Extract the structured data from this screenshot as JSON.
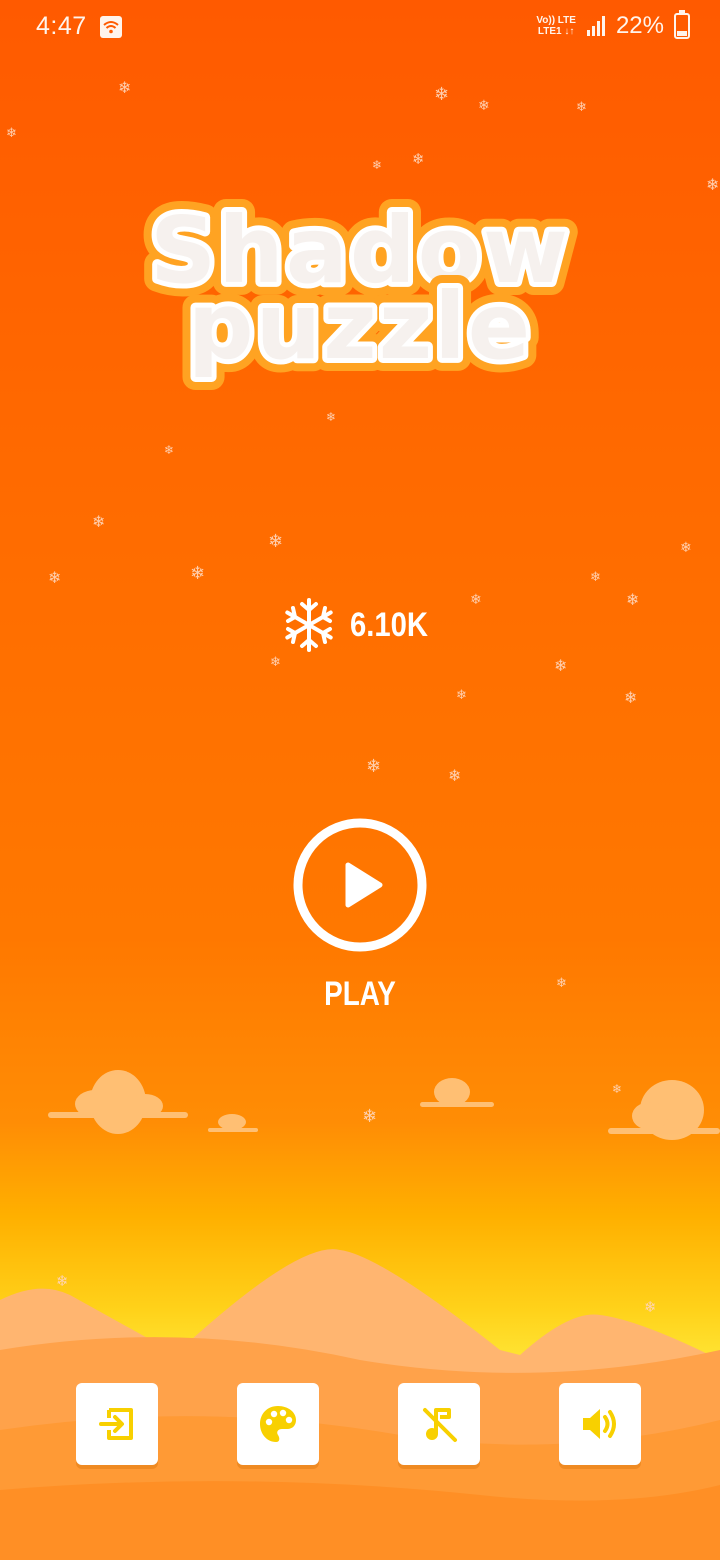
{
  "status_bar": {
    "time": "4:47",
    "network_top": "Vo)) LTE",
    "network_bottom": "LTE1 ↓↑",
    "battery_percent": "22%"
  },
  "game": {
    "title_line1": "Shadow",
    "title_line2": "puzzle",
    "snowflake_count": "6.10K",
    "play_label": "PLAY"
  },
  "bottom_bar": {
    "buttons": [
      {
        "name": "exit",
        "icon": "exit-icon"
      },
      {
        "name": "theme",
        "icon": "palette-icon"
      },
      {
        "name": "music",
        "icon": "music-off-icon"
      },
      {
        "name": "sound",
        "icon": "sound-on-icon"
      }
    ]
  },
  "colors": {
    "accent": "#f8d000",
    "background_top": "#ff5a00",
    "background_bottom": "#ff8a10"
  }
}
